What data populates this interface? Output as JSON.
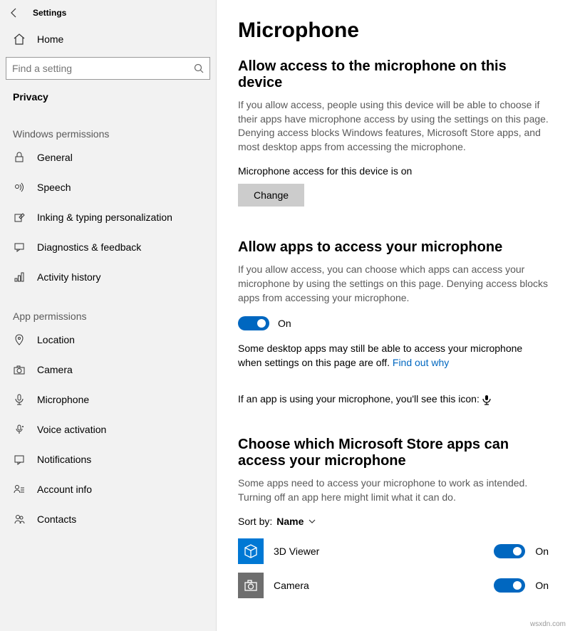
{
  "header": {
    "title": "Settings"
  },
  "home_label": "Home",
  "search": {
    "placeholder": "Find a setting"
  },
  "category": "Privacy",
  "groups": {
    "windows": {
      "label": "Windows permissions",
      "items": [
        "General",
        "Speech",
        "Inking & typing personalization",
        "Diagnostics & feedback",
        "Activity history"
      ]
    },
    "app": {
      "label": "App permissions",
      "items": [
        "Location",
        "Camera",
        "Microphone",
        "Voice activation",
        "Notifications",
        "Account info",
        "Contacts"
      ]
    }
  },
  "main": {
    "title": "Microphone",
    "section1": {
      "heading": "Allow access to the microphone on this device",
      "desc": "If you allow access, people using this device will be able to choose if their apps have microphone access by using the settings on this page. Denying access blocks Windows features, Microsoft Store apps, and most desktop apps from accessing the microphone.",
      "status": "Microphone access for this device is on",
      "change": "Change"
    },
    "section2": {
      "heading": "Allow apps to access your microphone",
      "desc": "If you allow access, you can choose which apps can access your microphone by using the settings on this page. Denying access blocks apps from accessing your microphone.",
      "toggle_state": "On",
      "note_a": "Some desktop apps may still be able to access your microphone when settings on this page are off. ",
      "note_link": "Find out why",
      "note_b": "If an app is using your microphone, you'll see this icon: "
    },
    "section3": {
      "heading": "Choose which Microsoft Store apps can access your microphone",
      "desc": "Some apps need to access your microphone to work as intended. Turning off an app here might limit what it can do.",
      "sort_label": "Sort by:",
      "sort_value": "Name",
      "apps": [
        {
          "name": "3D Viewer",
          "state": "On"
        },
        {
          "name": "Camera",
          "state": "On"
        }
      ]
    }
  },
  "watermark": "wsxdn.com"
}
